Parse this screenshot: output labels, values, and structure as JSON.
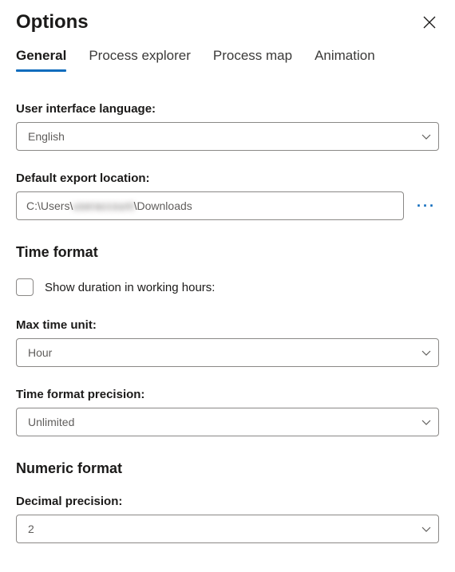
{
  "header": {
    "title": "Options"
  },
  "tabs": [
    "General",
    "Process explorer",
    "Process map",
    "Animation"
  ],
  "general": {
    "ui_language": {
      "label": "User interface language:",
      "value": "English"
    },
    "default_export_location": {
      "label": "Default export location:",
      "prefix": "C:\\Users\\",
      "redacted": "useraccount",
      "suffix": "\\Downloads"
    }
  },
  "time_format": {
    "heading": "Time format",
    "show_duration": {
      "label": "Show duration in working hours:",
      "checked": false
    },
    "max_time_unit": {
      "label": "Max time unit:",
      "value": "Hour"
    },
    "time_format_precision": {
      "label": "Time format precision:",
      "value": "Unlimited"
    }
  },
  "numeric_format": {
    "heading": "Numeric format",
    "decimal_precision": {
      "label": "Decimal precision:",
      "value": "2"
    }
  }
}
